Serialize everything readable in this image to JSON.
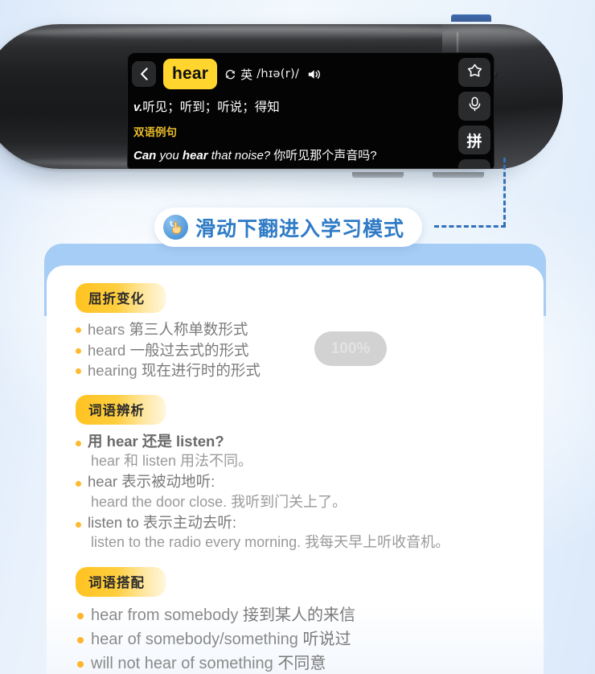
{
  "device": {
    "screen": {
      "back_icon": "chevron-left-icon",
      "word": "hear",
      "refresh_icon": "refresh-icon",
      "accent_label": "英",
      "phonetic": "/hɪə(r)/",
      "speaker_icon": "speaker-icon",
      "definition_pos": "v.",
      "definition_text": "听见；听到；听说；得知",
      "example_tag": "双语例句",
      "example_en_1": "Can",
      "example_en_2": "you",
      "example_en_3": "hear",
      "example_en_4": "that noise?",
      "example_cn": "你听见那个声音吗?",
      "rail": [
        {
          "name": "favorite-star-icon",
          "label": ""
        },
        {
          "name": "microphone-icon",
          "label": ""
        },
        {
          "name": "pinyin-button",
          "label": "拼"
        }
      ]
    }
  },
  "banner": {
    "icon": "swipe-hand-icon",
    "text": "滑动下翻进入学习模式"
  },
  "progress": {
    "value": "100%"
  },
  "sections": [
    {
      "badge": "屈折变化",
      "items": [
        {
          "en": "hears",
          "cn": "第三人称单数形式"
        },
        {
          "en": "heard",
          "cn": "一般过去式的形式"
        },
        {
          "en": "hearing",
          "cn": "现在进行时的形式"
        }
      ]
    },
    {
      "badge": "词语辨析",
      "items": [
        {
          "head": "用 hear 还是 listen?",
          "sub": "hear 和 listen 用法不同。"
        },
        {
          "head": "hear 表示被动地听:",
          "sub": "heard the door close. 我听到门关上了。"
        },
        {
          "head": "listen to 表示主动去听:",
          "sub": "listen to the radio every morning. 我每天早上听收音机。"
        }
      ]
    },
    {
      "badge": "词语搭配",
      "items": [
        {
          "en": "hear from somebody",
          "cn": "接到某人的来信"
        },
        {
          "en": "hear of somebody/something",
          "cn": "听说过"
        },
        {
          "en": "will not hear of something",
          "cn": "不同意"
        }
      ]
    }
  ],
  "colors": {
    "accent_yellow": "#FFD52E",
    "badge_orange": "#FFC220",
    "bullet_orange": "#FFB92E",
    "banner_blue": "#2F7BC6",
    "card_blue": "#A5CDF5",
    "dash_blue": "#3470B8"
  }
}
